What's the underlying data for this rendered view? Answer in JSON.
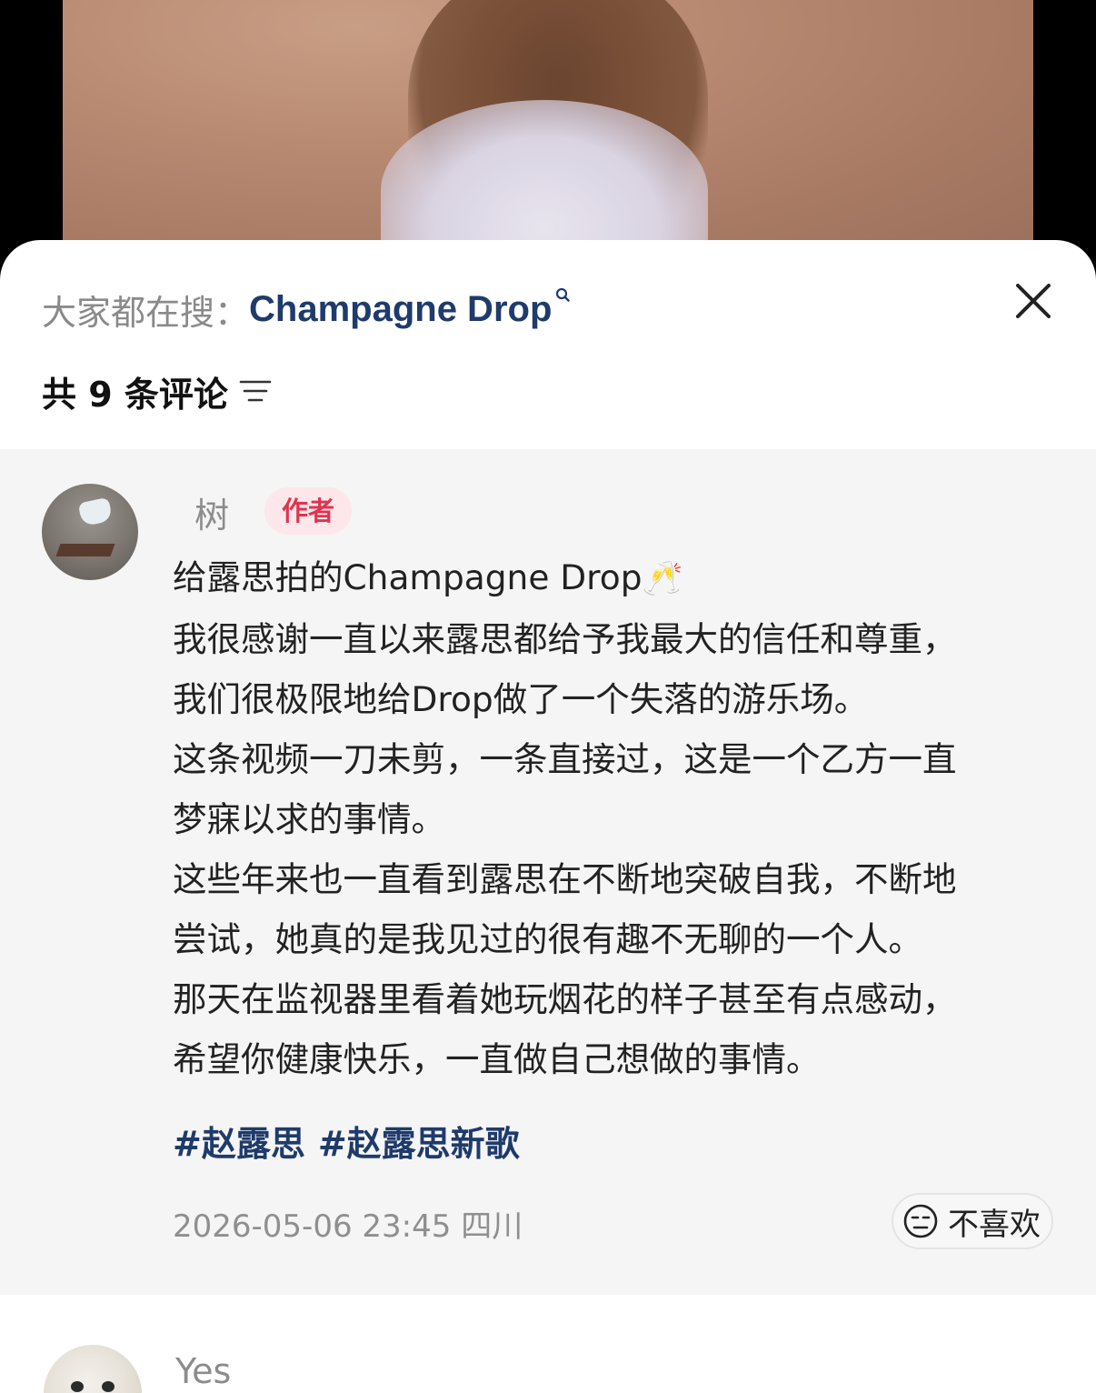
{
  "header": {
    "search_prefix": "大家都在搜：",
    "search_term": "Champagne Drop",
    "comment_count": "共 9 条评论"
  },
  "comment": {
    "author": "树",
    "badge": "作者",
    "lines": [
      "给露思拍的Champagne Drop",
      "我很感谢一直以来露思都给予我最大的信任和尊重，",
      "我们很极限地给Drop做了一个失落的游乐场。",
      "这条视频一刀未剪，一条直接过，这是一个乙方一直",
      "梦寐以求的事情。",
      "这些年来也一直看到露思在不断地突破自我，不断地",
      "尝试，她真的是我见过的很有趣不无聊的一个人。",
      "那天在监视器里看着她玩烟花的样子甚至有点感动，",
      "希望你健康快乐，一直做自己想做的事情。"
    ],
    "emoji": "🥂",
    "tags": [
      "#赵露思",
      "#赵露思新歌"
    ],
    "timestamp": "2026-05-06 23:45",
    "location": "四川",
    "dislike_label": "不喜欢"
  },
  "next_comment": {
    "author": "Yes"
  },
  "colors": {
    "link": "#1f3b6b",
    "badge_bg": "#fde7ea",
    "badge_text": "#e0344e",
    "card_bg": "#f5f5f5"
  },
  "icons": {
    "search": "search-icon",
    "close": "close-icon",
    "sort": "sort-icon",
    "dislike": "unamused-face-icon"
  }
}
